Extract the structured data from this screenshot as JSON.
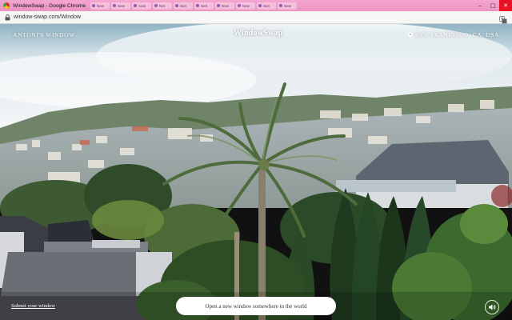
{
  "browser": {
    "window_title": "WindowSwap - Google Chrome",
    "url": "window-swap.com/Window",
    "background_tabs": [
      "New",
      "New",
      "Auto",
      "Net",
      "Nen",
      "Nen",
      "New",
      "New",
      "Nen",
      "New"
    ]
  },
  "page": {
    "brand": "ANTONI'S WINDOW",
    "logo": "WindowSwap",
    "location": "SAN FRANCISCO, CA, USA",
    "submit_link": "Submit your window",
    "open_button": "Open a new window somewhere in the world"
  },
  "icons": {
    "app": "chrome-icon",
    "lock": "lock-icon",
    "translate": "translate-icon",
    "location": "map-pin-icon",
    "sound": "speaker-icon"
  }
}
